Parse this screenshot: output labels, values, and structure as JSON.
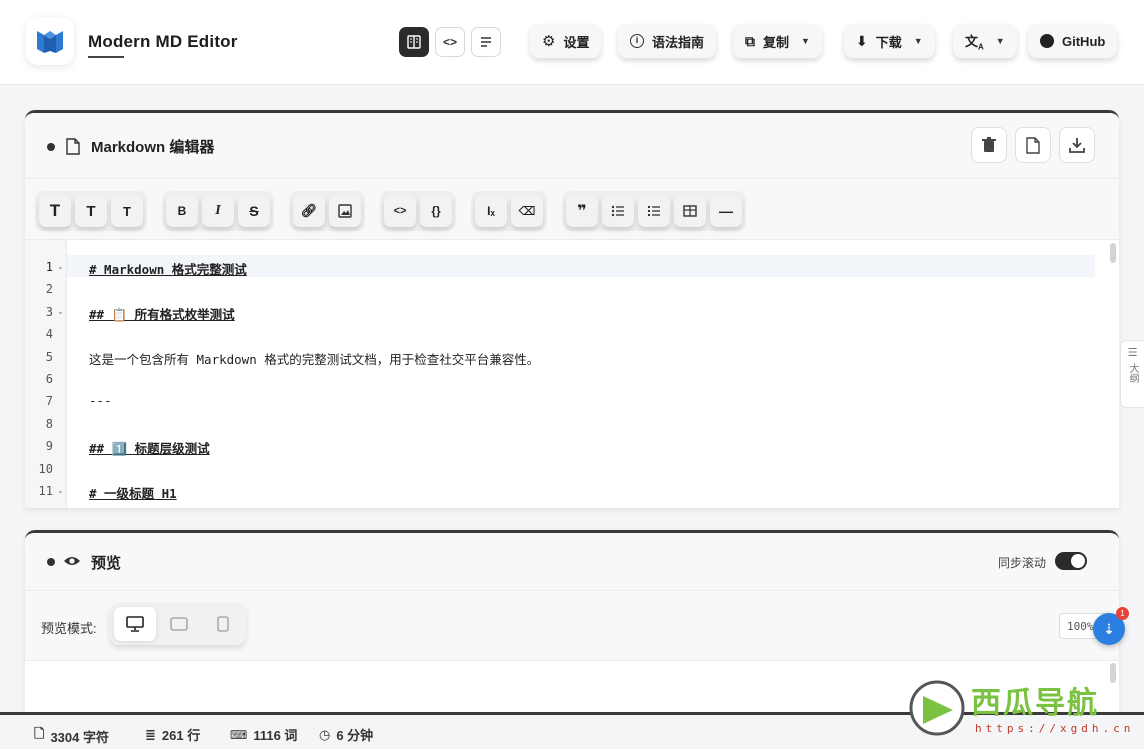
{
  "app": {
    "title": "Modern MD Editor"
  },
  "top_nav": {
    "settings": "设置",
    "syntax_guide": "语法指南",
    "copy": "复制",
    "download": "下载",
    "translate_icon": "translate-icon",
    "github": "GitHub"
  },
  "editor": {
    "title": "Markdown 编辑器",
    "toolbar": [
      "T",
      "T",
      "T",
      "B",
      "I",
      "S",
      "link",
      "image",
      "<>",
      "{}",
      "formula",
      "clear",
      "quote",
      "ul",
      "ol",
      "table",
      "hr"
    ],
    "lines": [
      {
        "n": "1",
        "text": "# Markdown 格式完整测试",
        "fold": "⌄"
      },
      {
        "n": "2",
        "text": ""
      },
      {
        "n": "3",
        "text": "## 📋 所有格式枚举测试",
        "fold": "⌄"
      },
      {
        "n": "4",
        "text": ""
      },
      {
        "n": "5",
        "text": "这是一个包含所有 Markdown 格式的完整测试文档，用于检查社交平台兼容性。"
      },
      {
        "n": "6",
        "text": ""
      },
      {
        "n": "7",
        "text": "---"
      },
      {
        "n": "8",
        "text": ""
      },
      {
        "n": "9",
        "text": "## 1️⃣ 标题层级测试"
      },
      {
        "n": "10",
        "text": ""
      },
      {
        "n": "11",
        "text": "# 一级标题 H1",
        "fold": "⌄"
      }
    ],
    "outline_label": "大纲"
  },
  "preview": {
    "title": "预览",
    "sync_scroll": "同步滚动",
    "mode_label": "预览模式:",
    "zoom": "100%",
    "badge": "1"
  },
  "status": {
    "chars": "3304 字符",
    "lines": "261 行",
    "words": "1116 词",
    "minutes": "6 分钟"
  },
  "watermark": {
    "name": "西瓜导航",
    "url": "https://xgdh.cn"
  }
}
